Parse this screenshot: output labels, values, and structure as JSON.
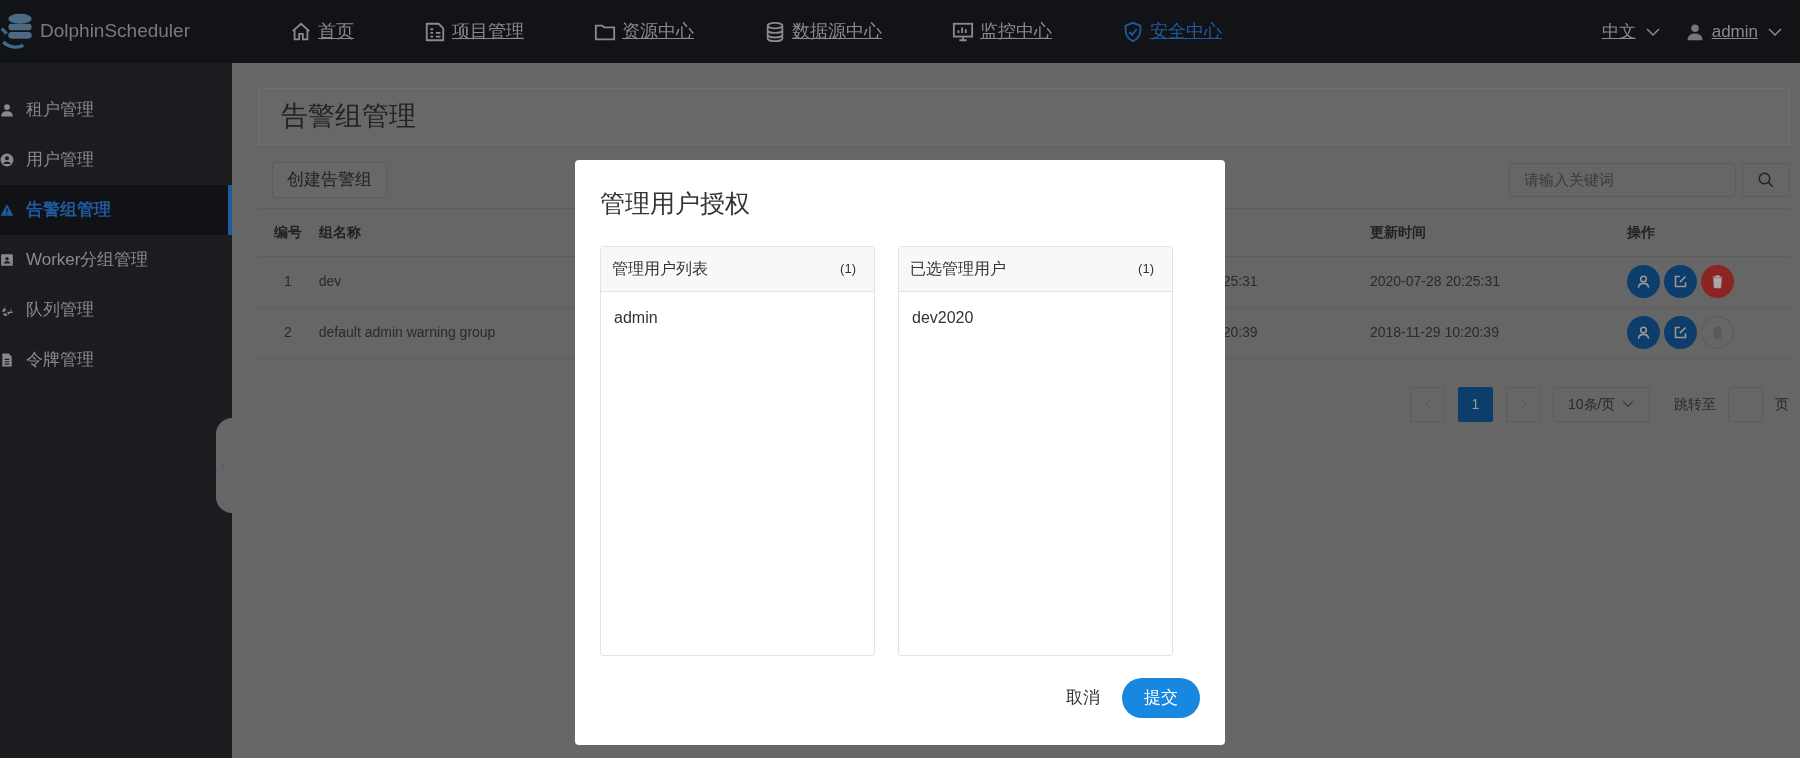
{
  "header": {
    "logo_text": "DolphinScheduler",
    "nav": [
      {
        "label": "首页",
        "kind": "home",
        "selected": false
      },
      {
        "label": "项目管理",
        "kind": "project",
        "selected": false
      },
      {
        "label": "资源中心",
        "kind": "folder",
        "selected": false
      },
      {
        "label": "数据源中心",
        "kind": "database",
        "selected": false
      },
      {
        "label": "监控中心",
        "kind": "monitor",
        "selected": false
      },
      {
        "label": "安全中心",
        "kind": "shield",
        "selected": true
      }
    ],
    "language": "中文",
    "user": "admin"
  },
  "sidebar": {
    "items": [
      {
        "label": "租户管理",
        "kind": "person",
        "selected": false
      },
      {
        "label": "用户管理",
        "kind": "person-circle",
        "selected": false
      },
      {
        "label": "告警组管理",
        "kind": "warning",
        "selected": true
      },
      {
        "label": "Worker分组管理",
        "kind": "id-card",
        "selected": false
      },
      {
        "label": "队列管理",
        "kind": "recycle",
        "selected": false
      },
      {
        "label": "令牌管理",
        "kind": "file",
        "selected": false
      }
    ]
  },
  "page": {
    "title": "告警组管理",
    "create_button": "创建告警组",
    "search": {
      "placeholder": "请输入关键词"
    },
    "table": {
      "columns": [
        "编号",
        "组名称",
        "",
        "更新时间",
        "操作"
      ],
      "rows": [
        {
          "number": "1",
          "name": "dev",
          "column_3": "25:31",
          "updated": "2020-07-28 20:25:31",
          "delete_disabled": false
        },
        {
          "number": "2",
          "name": "default admin warning group",
          "column_3": "20:39",
          "updated": "2018-11-29 10:20:39",
          "delete_disabled": true
        }
      ]
    },
    "pagination": {
      "pages": [
        {
          "label": "1",
          "selected": true
        }
      ],
      "page_size": "10条/页",
      "jump_label": "跳转至",
      "page_unit": "页"
    }
  },
  "modal": {
    "title": "管理用户授权",
    "lists": [
      {
        "title": "管理用户列表",
        "count": "(1)",
        "items": [
          "admin"
        ]
      },
      {
        "title": "已选管理用户",
        "count": "(1)",
        "items": [
          "dev2020"
        ]
      }
    ],
    "cancel": "取消",
    "submit": "提交"
  }
}
